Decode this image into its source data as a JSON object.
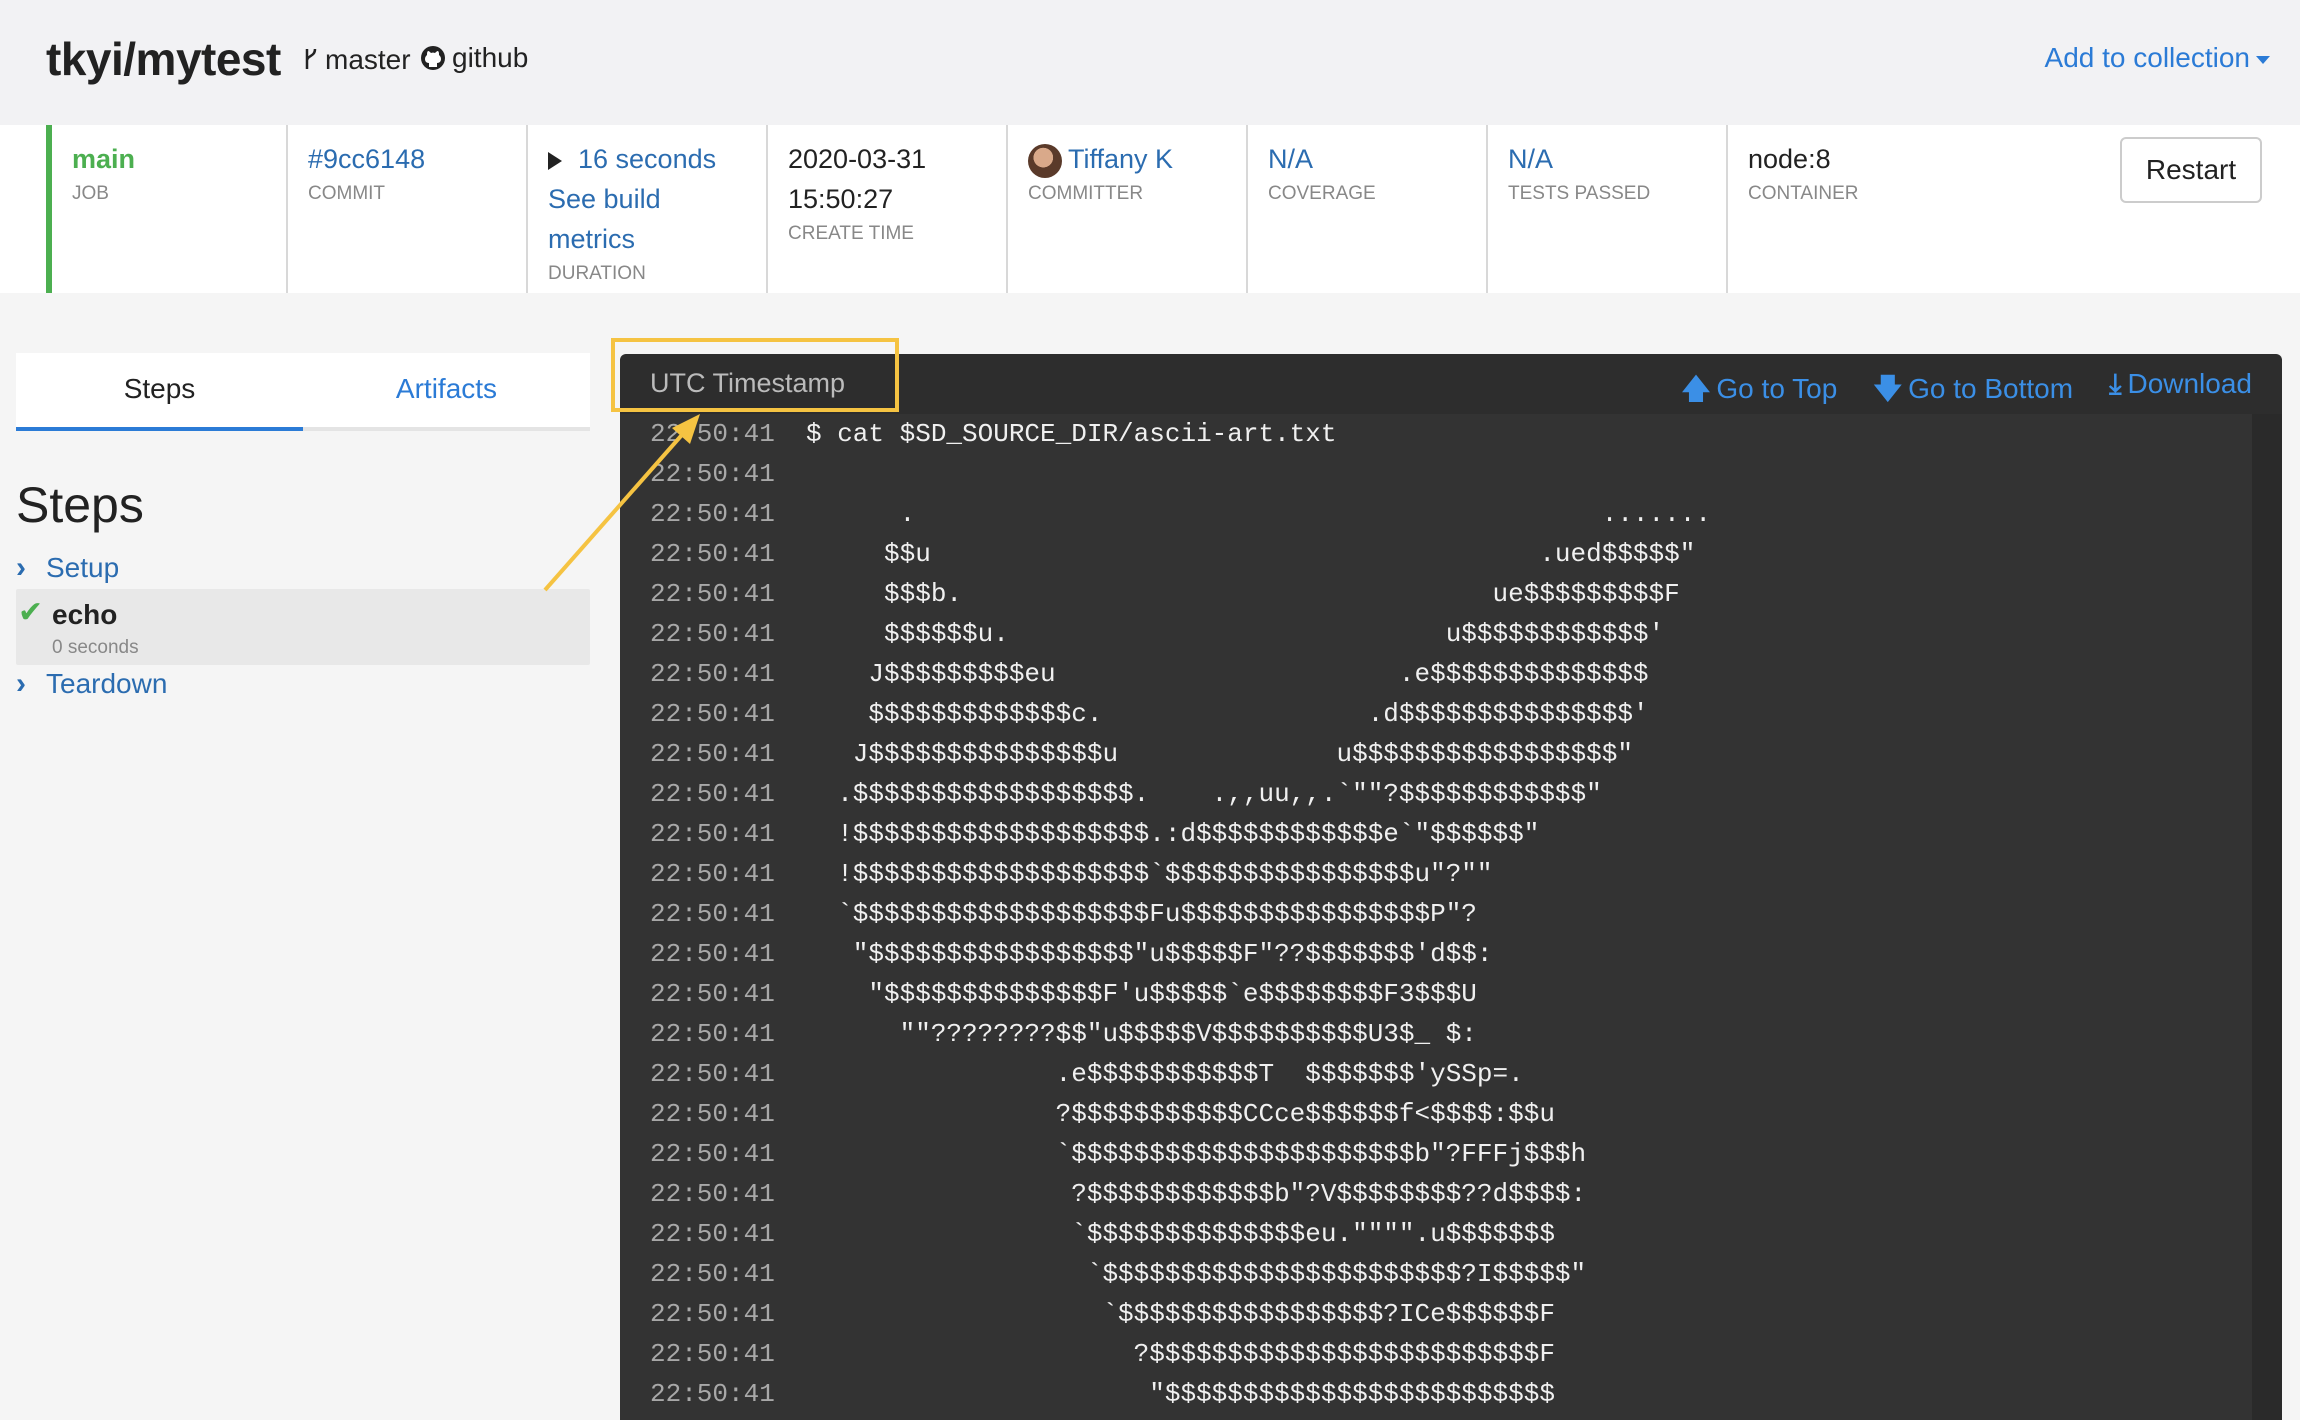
{
  "header": {
    "repo": "tkyi/mytest",
    "branch": "master",
    "source": "github",
    "add_collection": "Add to collection"
  },
  "info": {
    "job": {
      "value": "main",
      "label": "JOB"
    },
    "commit": {
      "value": "#9cc6148",
      "label": "COMMIT"
    },
    "duration": {
      "value": "16 seconds",
      "link": "See build metrics",
      "label": "DURATION"
    },
    "create_time": {
      "date": "2020-03-31",
      "time": "15:50:27",
      "label": "CREATE TIME"
    },
    "committer": {
      "value": "Tiffany K",
      "label": "COMMITTER"
    },
    "coverage": {
      "value": "N/A",
      "label": "COVERAGE"
    },
    "tests": {
      "value": "N/A",
      "label": "TESTS PASSED"
    },
    "container": {
      "value": "node:8",
      "label": "CONTAINER"
    },
    "restart": "Restart"
  },
  "sidebar": {
    "tabs": [
      "Steps",
      "Artifacts"
    ],
    "title": "Steps",
    "steps": [
      {
        "name": "Setup"
      },
      {
        "name": "echo",
        "sub": "0 seconds"
      },
      {
        "name": "Teardown"
      }
    ]
  },
  "log": {
    "timestamp_label": "UTC Timestamp",
    "go_top": "Go to Top",
    "go_bottom": "Go to Bottom",
    "download": "Download",
    "lines": [
      {
        "t": "22:50:41",
        "m": "$ cat $SD_SOURCE_DIR/ascii-art.txt"
      },
      {
        "t": "22:50:41",
        "m": ""
      },
      {
        "t": "22:50:41",
        "m": "      .                                            ......."
      },
      {
        "t": "22:50:41",
        "m": "     $$u                                       .ued$$$$$\""
      },
      {
        "t": "22:50:41",
        "m": "     $$$b.                                  ue$$$$$$$$$F"
      },
      {
        "t": "22:50:41",
        "m": "     $$$$$$u.                            u$$$$$$$$$$$$'"
      },
      {
        "t": "22:50:41",
        "m": "    J$$$$$$$$$eu                      .e$$$$$$$$$$$$$$"
      },
      {
        "t": "22:50:41",
        "m": "    $$$$$$$$$$$$$c.                 .d$$$$$$$$$$$$$$$'"
      },
      {
        "t": "22:50:41",
        "m": "   J$$$$$$$$$$$$$$$u              u$$$$$$$$$$$$$$$$$\""
      },
      {
        "t": "22:50:41",
        "m": "  .$$$$$$$$$$$$$$$$$$.    .,,uu,,.`\"\"?$$$$$$$$$$$$\""
      },
      {
        "t": "22:50:41",
        "m": "  !$$$$$$$$$$$$$$$$$$$.:d$$$$$$$$$$$$e`\"$$$$$$\""
      },
      {
        "t": "22:50:41",
        "m": "  !$$$$$$$$$$$$$$$$$$$`$$$$$$$$$$$$$$$$u\"?\"\""
      },
      {
        "t": "22:50:41",
        "m": "  `$$$$$$$$$$$$$$$$$$$Fu$$$$$$$$$$$$$$$$P\"?"
      },
      {
        "t": "22:50:41",
        "m": "   \"$$$$$$$$$$$$$$$$$\"u$$$$$F\"??$$$$$$$'d$$:"
      },
      {
        "t": "22:50:41",
        "m": "    \"$$$$$$$$$$$$$$F'u$$$$$`e$$$$$$$$F3$$$U"
      },
      {
        "t": "22:50:41",
        "m": "      \"\"????????$$\"u$$$$$V$$$$$$$$$$U3$_ $:"
      },
      {
        "t": "22:50:41",
        "m": "                .e$$$$$$$$$$$T  $$$$$$$'ySSp=."
      },
      {
        "t": "22:50:41",
        "m": "                ?$$$$$$$$$$$CCce$$$$$$f<$$$$:$$u"
      },
      {
        "t": "22:50:41",
        "m": "                `$$$$$$$$$$$$$$$$$$$$$$b\"?FFFj$$$h"
      },
      {
        "t": "22:50:41",
        "m": "                 ?$$$$$$$$$$$$b\"?V$$$$$$$$??d$$$$:"
      },
      {
        "t": "22:50:41",
        "m": "                 `$$$$$$$$$$$$$$eu.\"\"\"\".u$$$$$$$"
      },
      {
        "t": "22:50:41",
        "m": "                  `$$$$$$$$$$$$$$$$$$$$$$$?I$$$$$\""
      },
      {
        "t": "22:50:41",
        "m": "                   `$$$$$$$$$$$$$$$$$?ICe$$$$$$F"
      },
      {
        "t": "22:50:41",
        "m": "                     ?$$$$$$$$$$$$$$$$$$$$$$$$$F"
      },
      {
        "t": "22:50:41",
        "m": "                      \"$$$$$$$$$$$$$$$$$$$$$$$$$"
      }
    ]
  }
}
